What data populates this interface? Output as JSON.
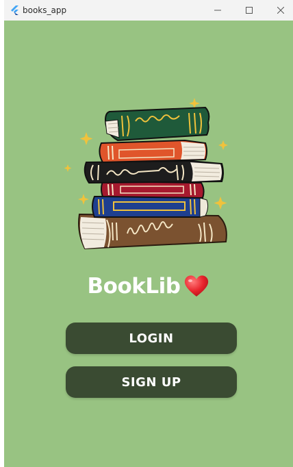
{
  "window": {
    "title": "books_app",
    "controls": {
      "minimize": "minimize-icon",
      "maximize": "maximize-icon",
      "close": "close-icon"
    }
  },
  "brand": {
    "title": "BookLib",
    "icon": "heart-icon"
  },
  "actions": {
    "login_label": "LOGIN",
    "signup_label": "SIGN UP"
  },
  "illustration": {
    "name": "book-stack-illustration",
    "spine_text": "llelelle"
  },
  "colors": {
    "background": "#98c382",
    "button": "#3a4b32",
    "button_text": "#ffffff",
    "heart": "#e8242c"
  }
}
